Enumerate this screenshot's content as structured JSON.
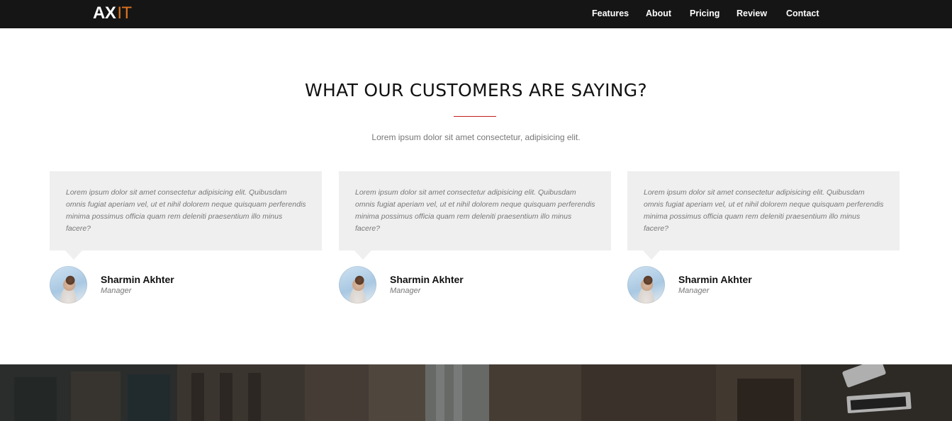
{
  "brand": {
    "logo_part1": "AX",
    "logo_part2": "IT",
    "accent": "#e0731f"
  },
  "nav": {
    "items": [
      "Features",
      "About",
      "Pricing",
      "Review",
      "Contact"
    ]
  },
  "testimonials_section": {
    "title": "WHAT OUR CUSTOMERS ARE SAYING?",
    "rule_color": "#c41e1e",
    "subtitle": "Lorem ipsum dolor sit amet consectetur, adipisicing elit.",
    "items": [
      {
        "quote": "Lorem ipsum dolor sit amet consectetur adipisicing elit. Quibusdam omnis fugiat aperiam vel, ut et nihil dolorem neque quisquam perferendis minima possimus officia quam rem deleniti praesentium illo minus facere?",
        "name": "Sharmin Akhter",
        "role": "Manager"
      },
      {
        "quote": "Lorem ipsum dolor sit amet consectetur adipisicing elit. Quibusdam omnis fugiat aperiam vel, ut et nihil dolorem neque quisquam perferendis minima possimus officia quam rem deleniti praesentium illo minus facere?",
        "name": "Sharmin Akhter",
        "role": "Manager"
      },
      {
        "quote": "Lorem ipsum dolor sit amet consectetur adipisicing elit. Quibusdam omnis fugiat aperiam vel, ut et nihil dolorem neque quisquam perferendis minima possimus officia quam rem deleniti praesentium illo minus facere?",
        "name": "Sharmin Akhter",
        "role": "Manager"
      }
    ]
  },
  "colors": {
    "navbar_bg": "#151515",
    "bubble_bg": "#efefef",
    "muted_text": "#777777"
  }
}
